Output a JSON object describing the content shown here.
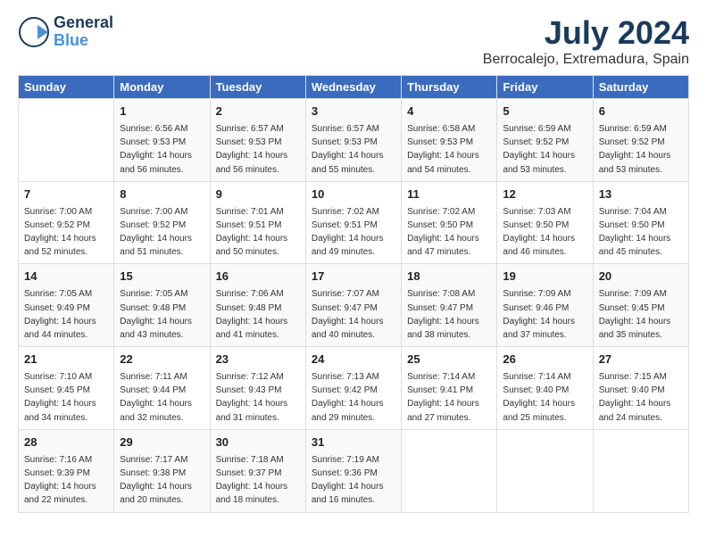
{
  "header": {
    "logo_general": "General",
    "logo_blue": "Blue",
    "title": "July 2024",
    "location": "Berrocalejo, Extremadura, Spain"
  },
  "weekdays": [
    "Sunday",
    "Monday",
    "Tuesday",
    "Wednesday",
    "Thursday",
    "Friday",
    "Saturday"
  ],
  "weeks": [
    [
      {
        "day": "",
        "info": ""
      },
      {
        "day": "1",
        "info": "Sunrise: 6:56 AM\nSunset: 9:53 PM\nDaylight: 14 hours\nand 56 minutes."
      },
      {
        "day": "2",
        "info": "Sunrise: 6:57 AM\nSunset: 9:53 PM\nDaylight: 14 hours\nand 56 minutes."
      },
      {
        "day": "3",
        "info": "Sunrise: 6:57 AM\nSunset: 9:53 PM\nDaylight: 14 hours\nand 55 minutes."
      },
      {
        "day": "4",
        "info": "Sunrise: 6:58 AM\nSunset: 9:53 PM\nDaylight: 14 hours\nand 54 minutes."
      },
      {
        "day": "5",
        "info": "Sunrise: 6:59 AM\nSunset: 9:52 PM\nDaylight: 14 hours\nand 53 minutes."
      },
      {
        "day": "6",
        "info": "Sunrise: 6:59 AM\nSunset: 9:52 PM\nDaylight: 14 hours\nand 53 minutes."
      }
    ],
    [
      {
        "day": "7",
        "info": "Sunrise: 7:00 AM\nSunset: 9:52 PM\nDaylight: 14 hours\nand 52 minutes."
      },
      {
        "day": "8",
        "info": "Sunrise: 7:00 AM\nSunset: 9:52 PM\nDaylight: 14 hours\nand 51 minutes."
      },
      {
        "day": "9",
        "info": "Sunrise: 7:01 AM\nSunset: 9:51 PM\nDaylight: 14 hours\nand 50 minutes."
      },
      {
        "day": "10",
        "info": "Sunrise: 7:02 AM\nSunset: 9:51 PM\nDaylight: 14 hours\nand 49 minutes."
      },
      {
        "day": "11",
        "info": "Sunrise: 7:02 AM\nSunset: 9:50 PM\nDaylight: 14 hours\nand 47 minutes."
      },
      {
        "day": "12",
        "info": "Sunrise: 7:03 AM\nSunset: 9:50 PM\nDaylight: 14 hours\nand 46 minutes."
      },
      {
        "day": "13",
        "info": "Sunrise: 7:04 AM\nSunset: 9:50 PM\nDaylight: 14 hours\nand 45 minutes."
      }
    ],
    [
      {
        "day": "14",
        "info": "Sunrise: 7:05 AM\nSunset: 9:49 PM\nDaylight: 14 hours\nand 44 minutes."
      },
      {
        "day": "15",
        "info": "Sunrise: 7:05 AM\nSunset: 9:48 PM\nDaylight: 14 hours\nand 43 minutes."
      },
      {
        "day": "16",
        "info": "Sunrise: 7:06 AM\nSunset: 9:48 PM\nDaylight: 14 hours\nand 41 minutes."
      },
      {
        "day": "17",
        "info": "Sunrise: 7:07 AM\nSunset: 9:47 PM\nDaylight: 14 hours\nand 40 minutes."
      },
      {
        "day": "18",
        "info": "Sunrise: 7:08 AM\nSunset: 9:47 PM\nDaylight: 14 hours\nand 38 minutes."
      },
      {
        "day": "19",
        "info": "Sunrise: 7:09 AM\nSunset: 9:46 PM\nDaylight: 14 hours\nand 37 minutes."
      },
      {
        "day": "20",
        "info": "Sunrise: 7:09 AM\nSunset: 9:45 PM\nDaylight: 14 hours\nand 35 minutes."
      }
    ],
    [
      {
        "day": "21",
        "info": "Sunrise: 7:10 AM\nSunset: 9:45 PM\nDaylight: 14 hours\nand 34 minutes."
      },
      {
        "day": "22",
        "info": "Sunrise: 7:11 AM\nSunset: 9:44 PM\nDaylight: 14 hours\nand 32 minutes."
      },
      {
        "day": "23",
        "info": "Sunrise: 7:12 AM\nSunset: 9:43 PM\nDaylight: 14 hours\nand 31 minutes."
      },
      {
        "day": "24",
        "info": "Sunrise: 7:13 AM\nSunset: 9:42 PM\nDaylight: 14 hours\nand 29 minutes."
      },
      {
        "day": "25",
        "info": "Sunrise: 7:14 AM\nSunset: 9:41 PM\nDaylight: 14 hours\nand 27 minutes."
      },
      {
        "day": "26",
        "info": "Sunrise: 7:14 AM\nSunset: 9:40 PM\nDaylight: 14 hours\nand 25 minutes."
      },
      {
        "day": "27",
        "info": "Sunrise: 7:15 AM\nSunset: 9:40 PM\nDaylight: 14 hours\nand 24 minutes."
      }
    ],
    [
      {
        "day": "28",
        "info": "Sunrise: 7:16 AM\nSunset: 9:39 PM\nDaylight: 14 hours\nand 22 minutes."
      },
      {
        "day": "29",
        "info": "Sunrise: 7:17 AM\nSunset: 9:38 PM\nDaylight: 14 hours\nand 20 minutes."
      },
      {
        "day": "30",
        "info": "Sunrise: 7:18 AM\nSunset: 9:37 PM\nDaylight: 14 hours\nand 18 minutes."
      },
      {
        "day": "31",
        "info": "Sunrise: 7:19 AM\nSunset: 9:36 PM\nDaylight: 14 hours\nand 16 minutes."
      },
      {
        "day": "",
        "info": ""
      },
      {
        "day": "",
        "info": ""
      },
      {
        "day": "",
        "info": ""
      }
    ]
  ]
}
